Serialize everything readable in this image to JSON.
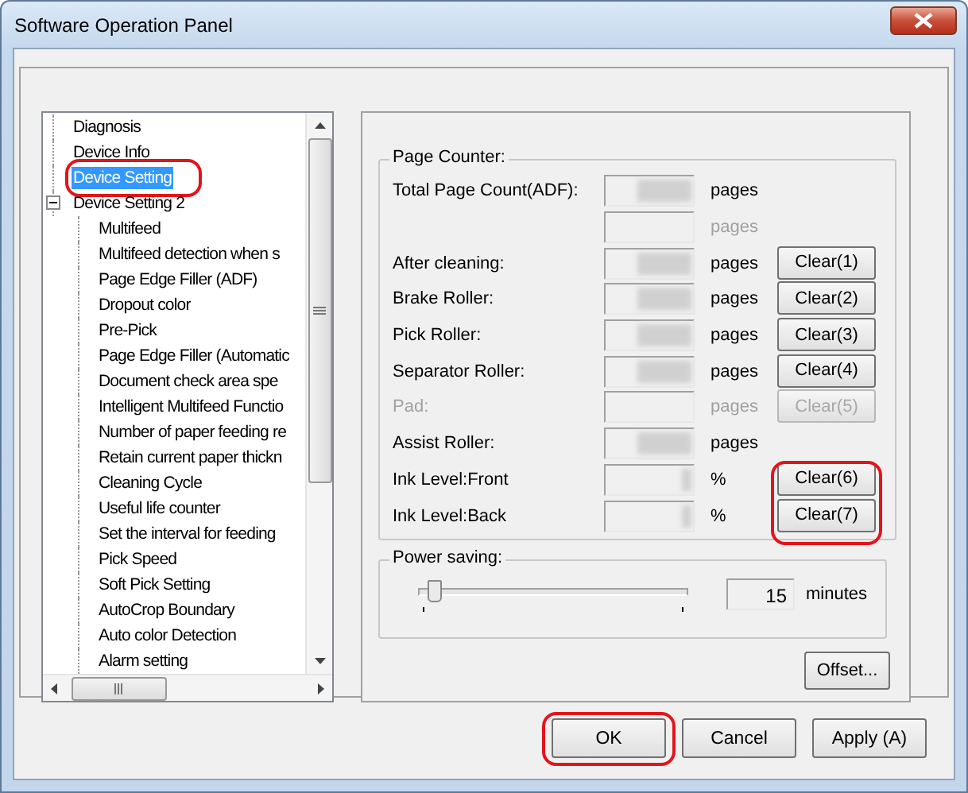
{
  "window": {
    "title": "Software Operation Panel"
  },
  "tree": {
    "items": [
      {
        "label": "Diagnosis",
        "selected": false,
        "highlighted": false
      },
      {
        "label": "Device Info",
        "selected": false,
        "highlighted": false
      },
      {
        "label": "Device Setting",
        "selected": true,
        "highlighted": true
      },
      {
        "label": "Device Setting 2",
        "selected": false,
        "highlighted": false,
        "expanded": true,
        "children": [
          {
            "label": "Multifeed",
            "selected": false,
            "highlighted": false
          },
          {
            "label": "Multifeed detection when s",
            "selected": false,
            "highlighted": false
          },
          {
            "label": "Page Edge Filler (ADF)",
            "selected": false,
            "highlighted": false
          },
          {
            "label": "Dropout color",
            "selected": false,
            "highlighted": false
          },
          {
            "label": "Pre-Pick",
            "selected": false,
            "highlighted": false
          },
          {
            "label": "Page Edge Filler (Automatic",
            "selected": false,
            "highlighted": false
          },
          {
            "label": "Document check area spe",
            "selected": false,
            "highlighted": false
          },
          {
            "label": "Intelligent Multifeed Functio",
            "selected": false,
            "highlighted": false
          },
          {
            "label": "Number of paper feeding re",
            "selected": false,
            "highlighted": false
          },
          {
            "label": "Retain current paper thickn",
            "selected": false,
            "highlighted": false
          },
          {
            "label": "Cleaning Cycle",
            "selected": false,
            "highlighted": false
          },
          {
            "label": "Useful life counter",
            "selected": false,
            "highlighted": false
          },
          {
            "label": "Set the interval for feeding",
            "selected": false,
            "highlighted": false
          },
          {
            "label": "Pick Speed",
            "selected": false,
            "highlighted": false
          },
          {
            "label": "Soft Pick Setting",
            "selected": false,
            "highlighted": false
          },
          {
            "label": "AutoCrop Boundary",
            "selected": false,
            "highlighted": false
          },
          {
            "label": "Auto color Detection",
            "selected": false,
            "highlighted": false
          },
          {
            "label": "Alarm setting",
            "selected": false,
            "highlighted": false
          }
        ]
      }
    ]
  },
  "page_counter": {
    "title": "Page Counter:",
    "rows": [
      {
        "label": "Total Page Count(ADF):",
        "unit": "pages",
        "disabled": false,
        "value_blurred": true
      },
      {
        "unit": "pages",
        "disabled": true,
        "value_blurred": false
      },
      {
        "label": "After cleaning:",
        "unit": "pages",
        "disabled": false,
        "value_blurred": true,
        "button": {
          "label": "Clear(1)",
          "disabled": false,
          "highlighted": false
        }
      },
      {
        "label": "Brake Roller:",
        "unit": "pages",
        "disabled": false,
        "value_blurred": true,
        "button": {
          "label": "Clear(2)",
          "disabled": false,
          "highlighted": false
        }
      },
      {
        "label": "Pick Roller:",
        "unit": "pages",
        "disabled": false,
        "value_blurred": true,
        "button": {
          "label": "Clear(3)",
          "disabled": false,
          "highlighted": false
        }
      },
      {
        "label": "Separator Roller:",
        "unit": "pages",
        "disabled": false,
        "value_blurred": true,
        "button": {
          "label": "Clear(4)",
          "disabled": false,
          "highlighted": false
        }
      },
      {
        "label": "Pad:",
        "unit": "pages",
        "disabled": true,
        "value_blurred": false,
        "button": {
          "label": "Clear(5)",
          "disabled": true,
          "highlighted": false
        }
      },
      {
        "label": "Assist Roller:",
        "unit": "pages",
        "disabled": false,
        "value_blurred": true
      },
      {
        "label": "Ink Level:Front",
        "unit": "%",
        "disabled": false,
        "value_blurred": true,
        "button": {
          "label": "Clear(6)",
          "disabled": false,
          "highlighted": true
        }
      },
      {
        "label": "Ink Level:Back",
        "unit": "%",
        "disabled": false,
        "value_blurred": true,
        "button": {
          "label": "Clear(7)",
          "disabled": false,
          "highlighted": true
        }
      }
    ]
  },
  "power_saving": {
    "title": "Power saving:",
    "slider": {
      "level": 0.04
    },
    "value": "15",
    "unit": "minutes"
  },
  "offset_button": {
    "label": "Offset..."
  },
  "buttons": [
    {
      "label": "OK",
      "highlighted": true
    },
    {
      "label": "Cancel",
      "highlighted": false
    },
    {
      "label": "Apply (A)",
      "highlighted": false
    }
  ]
}
